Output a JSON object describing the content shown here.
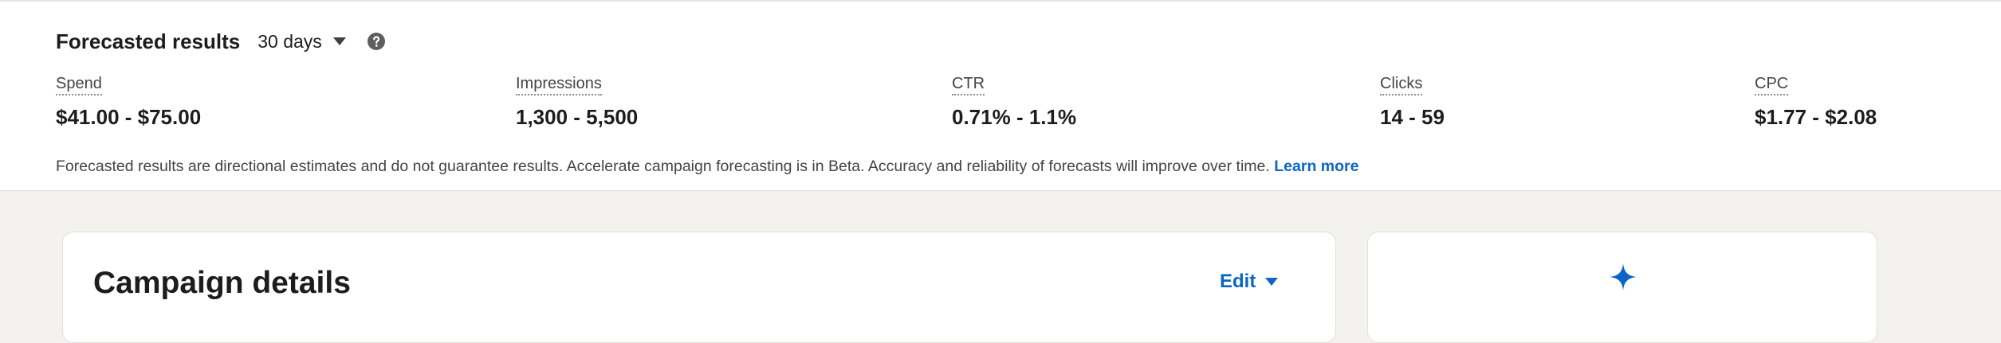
{
  "forecast": {
    "title": "Forecasted results",
    "period": "30 days",
    "metrics": [
      {
        "label": "Spend",
        "value": "$41.00 - $75.00"
      },
      {
        "label": "Impressions",
        "value": "1,300 - 5,500"
      },
      {
        "label": "CTR",
        "value": "0.71% - 1.1%"
      },
      {
        "label": "Clicks",
        "value": "14 - 59"
      },
      {
        "label": "CPC",
        "value": "$1.77 - $2.08"
      }
    ],
    "disclaimer": "Forecasted results are directional estimates and do not guarantee results. Accelerate campaign forecasting is in Beta. Accuracy and reliability of forecasts will improve over time.",
    "learn_more": "Learn more"
  },
  "campaign_details": {
    "title": "Campaign details",
    "edit_label": "Edit"
  },
  "icons": {
    "period_caret": "caret-down-icon",
    "help": "question-circle-icon",
    "edit_caret": "caret-down-icon",
    "side_card": "sparkle-icon"
  },
  "colors": {
    "accent": "#0a66c2",
    "background": "#f3f2ef",
    "text": "#1d1d1d"
  }
}
